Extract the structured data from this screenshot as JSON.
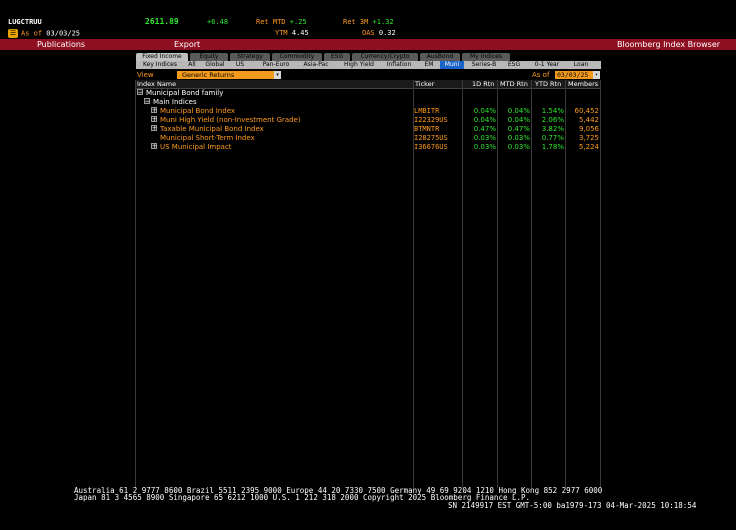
{
  "header": {
    "ticker": "LUGCTRUU",
    "price": "2611.89",
    "change": "+6.48",
    "ret_mtd_label": "Ret MTD",
    "ret_mtd": "+.25",
    "ret_3m_label": "Ret 3M",
    "ret_3m": "+1.32",
    "asof_label": "As of",
    "asof_date": "03/03/25",
    "ytm_label": "YTM",
    "ytm": "4.45",
    "oas_label": "OAS",
    "oas": "0.32"
  },
  "menubar": {
    "publications": "Publications",
    "export": "Export",
    "title": "Bloomberg Index Browser"
  },
  "tabs": [
    "Fixed Income",
    "Equity",
    "Strategy",
    "Commodity",
    "ESG",
    "Currency/Crypto",
    "AusBond",
    "My Indices"
  ],
  "subtabs": [
    "Key Indices",
    "All",
    "Global",
    "US",
    "Pan-Euro",
    "Asia-Pac",
    "High Yield",
    "Inflation",
    "EM",
    "Muni",
    "Series-B",
    "ESG",
    "0-1 Year",
    "Loan"
  ],
  "active_subtab": "Muni",
  "view": {
    "label": "View",
    "value": "Generic Returns",
    "asof_label": "As of",
    "asof_value": "03/03/25"
  },
  "table": {
    "columns": [
      "Index Name",
      "Ticker",
      "1D Rtn",
      "MTD Rtn",
      "YTD Rtn",
      "Members"
    ],
    "family": "Municipal Bond family",
    "group": "Main Indices",
    "rows": [
      {
        "name": "Municipal Bond Index",
        "ticker": "LMBITR",
        "d1": "0.04%",
        "mtd": "0.04%",
        "ytd": "1.54%",
        "members": "60,452",
        "expand": "+"
      },
      {
        "name": "Muni High Yield (non-Investment Grade)",
        "ticker": "I22329US",
        "d1": "0.04%",
        "mtd": "0.04%",
        "ytd": "2.06%",
        "members": "5,442",
        "expand": "+"
      },
      {
        "name": "Taxable Municipal Bond Index",
        "ticker": "BTMNTR",
        "d1": "0.47%",
        "mtd": "0.47%",
        "ytd": "3.82%",
        "members": "9,056",
        "expand": "+"
      },
      {
        "name": "Municipal Short-Term Index",
        "ticker": "I28275US",
        "d1": "0.03%",
        "mtd": "0.03%",
        "ytd": "0.77%",
        "members": "3,725",
        "expand": ""
      },
      {
        "name": "US Municipal Impact",
        "ticker": "I36676US",
        "d1": "0.03%",
        "mtd": "0.03%",
        "ytd": "1.78%",
        "members": "5,224",
        "expand": "+"
      }
    ]
  },
  "footer": {
    "line1": "Australia 61 2 9777 8600 Brazil 5511 2395 9000 Europe 44 20 7330 7500 Germany 49 69 9204 1210 Hong Kong 852 2977 6000",
    "line2": "Japan 81 3 4565 8900       Singapore 65 6212 1000       U.S. 1 212 318 2000          Copyright 2025 Bloomberg Finance L.P.",
    "line3": "SN 2149917 EST  GMT-5:00 ba1979-173 04-Mar-2025 10:18:54"
  },
  "colors": {
    "accent_orange": "#ff9a1e",
    "positive_green": "#2ee82e",
    "menubar_red": "#8e0f1f",
    "active_subtab_blue": "#1a63c9"
  }
}
